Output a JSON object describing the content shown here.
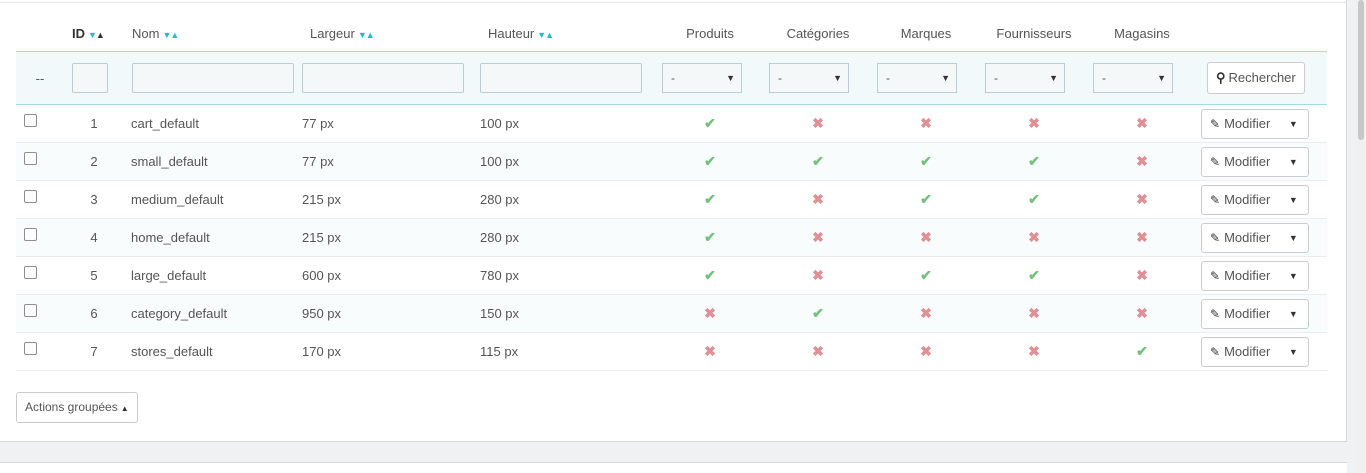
{
  "columns": {
    "id": "ID",
    "name": "Nom",
    "width": "Largeur",
    "height": "Hauteur",
    "products": "Produits",
    "categories": "Catégories",
    "brands": "Marques",
    "suppliers": "Fournisseurs",
    "stores": "Magasins"
  },
  "filters": {
    "select_all": "--",
    "select_value": "-",
    "search_label": "Rechercher"
  },
  "rows": [
    {
      "id": "1",
      "name": "cart_default",
      "width": "77 px",
      "height": "100 px",
      "products": true,
      "categories": false,
      "brands": false,
      "suppliers": false,
      "stores": false
    },
    {
      "id": "2",
      "name": "small_default",
      "width": "77 px",
      "height": "100 px",
      "products": true,
      "categories": true,
      "brands": true,
      "suppliers": true,
      "stores": false
    },
    {
      "id": "3",
      "name": "medium_default",
      "width": "215 px",
      "height": "280 px",
      "products": true,
      "categories": false,
      "brands": true,
      "suppliers": true,
      "stores": false
    },
    {
      "id": "4",
      "name": "home_default",
      "width": "215 px",
      "height": "280 px",
      "products": true,
      "categories": false,
      "brands": false,
      "suppliers": false,
      "stores": false
    },
    {
      "id": "5",
      "name": "large_default",
      "width": "600 px",
      "height": "780 px",
      "products": true,
      "categories": false,
      "brands": true,
      "suppliers": true,
      "stores": false
    },
    {
      "id": "6",
      "name": "category_default",
      "width": "950 px",
      "height": "150 px",
      "products": false,
      "categories": true,
      "brands": false,
      "suppliers": false,
      "stores": false
    },
    {
      "id": "7",
      "name": "stores_default",
      "width": "170 px",
      "height": "115 px",
      "products": false,
      "categories": false,
      "brands": false,
      "suppliers": false,
      "stores": true
    }
  ],
  "row_action": "Modifier",
  "bulk_actions": "Actions groupées",
  "colors": {
    "yes": "#72c279",
    "no": "#e08f95",
    "accent": "#25b9d7",
    "filter_bg": "#f2f9fb"
  },
  "icons": {
    "sort": "sort-arrows-icon",
    "search": "magnifier-icon",
    "edit": "pencil-icon",
    "dropdown": "caret-down-icon",
    "check": "check-icon",
    "cross": "cross-icon"
  }
}
